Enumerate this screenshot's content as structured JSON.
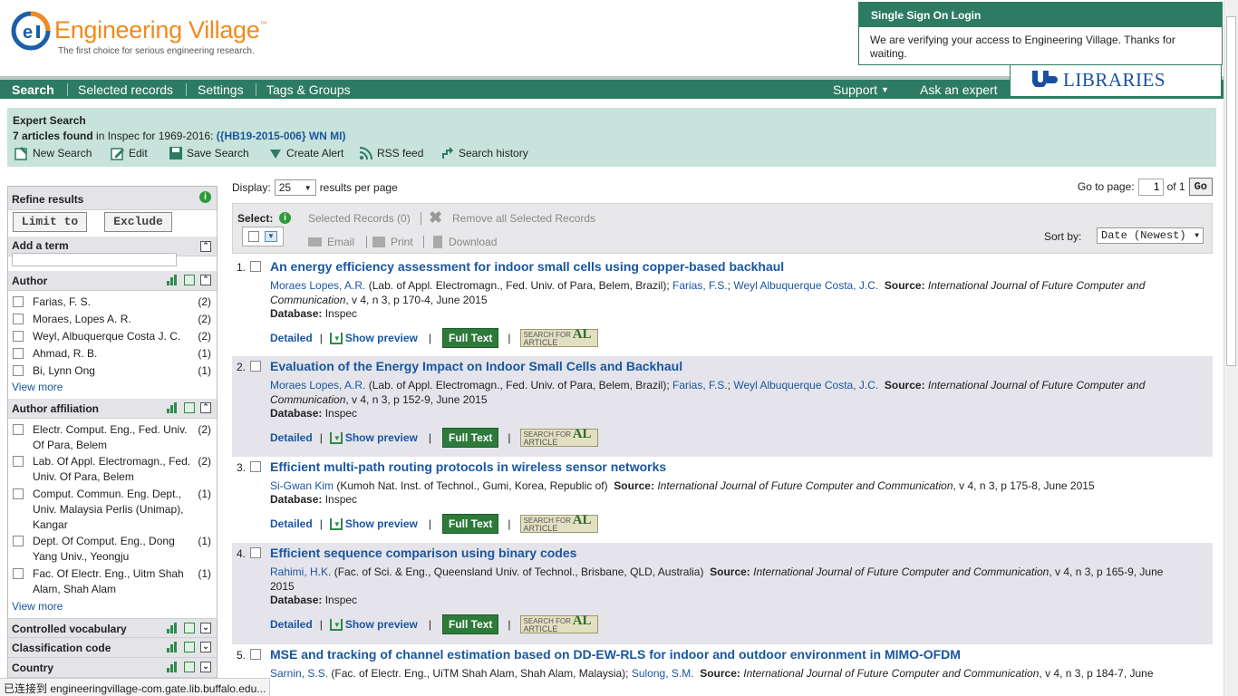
{
  "header": {
    "logo_title": "Engineering Village",
    "logo_tm": "™",
    "tagline": "The first choice for serious engineering research.",
    "sso_title": "Single Sign On Login",
    "sso_body": "We are verifying your access to Engineering Village. Thanks for waiting.",
    "ub_libraries": "LIBRARIES"
  },
  "nav": {
    "items": [
      "Search",
      "Selected records",
      "Settings",
      "Tags & Groups"
    ],
    "right": [
      "Support",
      "Ask an expert"
    ]
  },
  "expert": {
    "title": "Expert Search",
    "count": "7 articles found",
    "in_text": " in Inspec for 1969-2016: ",
    "query": "({HB19-2015-006} WN MI)",
    "tools": [
      "New Search",
      "Edit",
      "Save Search",
      "Create Alert",
      "RSS feed",
      "Search history"
    ]
  },
  "sidebar": {
    "refine_title": "Refine results",
    "limit_btn": "Limit to",
    "exclude_btn": "Exclude",
    "add_term": "Add a term",
    "author_title": "Author",
    "authors": [
      {
        "name": "Farias, F. S.",
        "count": "(2)"
      },
      {
        "name": "Moraes, Lopes A. R.",
        "count": "(2)"
      },
      {
        "name": "Weyl, Albuquerque Costa J. C.",
        "count": "(2)"
      },
      {
        "name": "Ahmad, R. B.",
        "count": "(1)"
      },
      {
        "name": "Bi, Lynn Ong",
        "count": "(1)"
      }
    ],
    "view_more": "View more",
    "affil_title": "Author affiliation",
    "affiliations": [
      {
        "name": "Electr. Comput. Eng., Fed. Univ. Of Para, Belem",
        "count": "(2)"
      },
      {
        "name": "Lab. Of Appl. Electromagn., Fed. Univ. Of Para, Belem",
        "count": "(2)"
      },
      {
        "name": "Comput. Commun. Eng. Dept., Univ. Malaysia Perlis (Unimap), Kangar",
        "count": "(1)"
      },
      {
        "name": "Dept. Of Comput. Eng., Dong Yang Univ., Yeongju",
        "count": "(1)"
      },
      {
        "name": "Fac. Of Electr. Eng., Uitm Shah Alam, Shah Alam",
        "count": "(1)"
      }
    ],
    "view_more2": "View more",
    "controlled": "Controlled vocabulary",
    "classification": "Classification code",
    "country": "Country"
  },
  "main": {
    "display_label": "Display:",
    "display_value": "25",
    "per_page": "results per page",
    "goto_label": "Go to page:",
    "goto_value": "1",
    "of_pages": "of 1",
    "go_btn": "Go",
    "select_label": "Select:",
    "selected_records": "Selected Records (0)",
    "remove_all": "Remove all Selected Records",
    "email": "Email",
    "print": "Print",
    "download": "Download",
    "sort_label": "Sort by:",
    "sort_value": "Date (Newest)"
  },
  "results": [
    {
      "num": "1.",
      "title": "An energy efficiency assessment for indoor small cells using copper-based backhaul",
      "a1": "Moraes Lopes, A.R.",
      "a1aff": " (Lab. of Appl. Electromagn., Fed. Univ. of Para, Belem, Brazil); ",
      "a2": "Farias, F.S.",
      "sep": "; ",
      "a3": "Weyl Albuquerque Costa, J.C.",
      "src_label": "Source:",
      "src": "International Journal of Future Computer and Communication",
      "rest": ", v 4, n 3, p 170-4, June 2015",
      "db_label": "Database:",
      "db": "Inspec"
    },
    {
      "num": "2.",
      "title": "Evaluation of the Energy Impact on Indoor Small Cells and Backhaul",
      "a1": "Moraes Lopes, A.R.",
      "a1aff": " (Lab. of Appl. Electromagn., Fed. Univ. of Para, Belem, Brazil); ",
      "a2": "Farias, F.S.",
      "sep": "; ",
      "a3": "Weyl Albuquerque Costa, J.C.",
      "src_label": "Source:",
      "src": "International Journal of Future Computer and Communication",
      "rest": ", v 4, n 3, p 152-9, June 2015",
      "db_label": "Database:",
      "db": "Inspec"
    },
    {
      "num": "3.",
      "title": "Efficient multi-path routing protocols in wireless sensor networks",
      "a1": "Si-Gwan Kim",
      "a1aff": " (Kumoh Nat. Inst. of Technol., Gumi, Korea, Republic of) ",
      "src_label": "Source:",
      "src": "International Journal of Future Computer and Communication",
      "rest": ", v 4, n 3, p 175-8, June 2015",
      "db_label": "Database:",
      "db": "Inspec"
    },
    {
      "num": "4.",
      "title": "Efficient sequence comparison using binary codes",
      "a1": "Rahimi, H.K.",
      "a1aff": " (Fac. of Sci. & Eng., Queensland Univ. of Technol., Brisbane, QLD, Australia) ",
      "src_label": "Source:",
      "src": "International Journal of Future Computer and Communication",
      "rest": ", v 4, n 3, p 165-9, June 2015",
      "db_label": "Database:",
      "db": "Inspec"
    },
    {
      "num": "5.",
      "title": "MSE and tracking of channel estimation based on DD-EW-RLS for indoor and outdoor environment in MIMO-OFDM",
      "a1": "Sarnin, S.S.",
      "a1aff": " (Fac. of Electr. Eng., UiTM Shah Alam, Shah Alam, Malaysia); ",
      "a2": "Sulong, S.M.",
      "src_label": "Source:",
      "src": "International Journal of Future Computer and Communication",
      "rest": ", v 4, n 3, p 184-7, June"
    }
  ],
  "actions": {
    "detailed": "Detailed",
    "preview": "Show preview",
    "fulltext": "Full Text",
    "sfa_top": "SEARCH FOR",
    "sfa_bot": "ARTICLE",
    "sfa_al": "AL"
  },
  "status": "已连接到 engineeringvillage-com.gate.lib.buffalo.edu...",
  "colors": {
    "brand_green": "#2d7b63",
    "orange": "#f08a1c",
    "link": "#1a56a0"
  }
}
